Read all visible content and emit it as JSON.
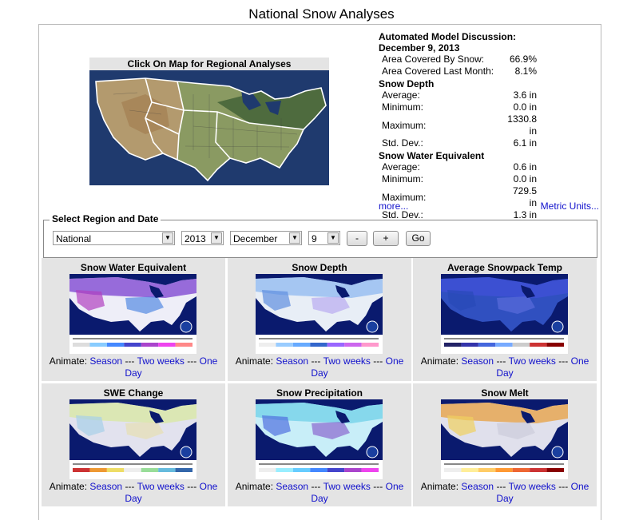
{
  "page": {
    "title": "National Snow Analyses"
  },
  "map": {
    "caption": "Click On Map for Regional Analyses"
  },
  "discussion": {
    "heading": "Automated Model Discussion:",
    "date": "December 9, 2013",
    "coverage": [
      {
        "label": "Area Covered By Snow:",
        "value": "66.9%"
      },
      {
        "label": "Area Covered Last Month:",
        "value": "8.1%"
      }
    ],
    "snow_depth": {
      "title": "Snow Depth",
      "rows": [
        {
          "label": "Average:",
          "value": "3.6 in"
        },
        {
          "label": "Minimum:",
          "value": "0.0 in"
        },
        {
          "label": "Maximum:",
          "value": "1330.8 in"
        },
        {
          "label": "Std. Dev.:",
          "value": "6.1 in"
        }
      ]
    },
    "swe": {
      "title": "Snow Water Equivalent",
      "rows": [
        {
          "label": "Average:",
          "value": "0.6 in"
        },
        {
          "label": "Minimum:",
          "value": "0.0 in"
        },
        {
          "label": "Maximum:",
          "value": "729.5 in"
        },
        {
          "label": "Std. Dev.:",
          "value": "1.3 in"
        }
      ]
    },
    "more_link": "more...",
    "metric_link": "Metric Units..."
  },
  "selector": {
    "legend": "Select Region and Date",
    "region": "National",
    "year": "2013",
    "month": "December",
    "day": "9",
    "minus": "-",
    "plus": "+",
    "go": "Go"
  },
  "panels": [
    {
      "title": "Snow Water Equivalent",
      "palette": "swe"
    },
    {
      "title": "Snow Depth",
      "palette": "depth"
    },
    {
      "title": "Average Snowpack Temp",
      "palette": "temp"
    },
    {
      "title": "SWE Change",
      "palette": "change"
    },
    {
      "title": "Snow Precipitation",
      "palette": "precip"
    },
    {
      "title": "Snow Melt",
      "palette": "melt"
    }
  ],
  "animate": {
    "label": "Animate:",
    "season": "Season",
    "sep": "---",
    "two_weeks": "Two weeks",
    "one": "One",
    "day": "Day"
  },
  "colors": {
    "link": "#1111cc",
    "panel_bg": "#e4e4e4",
    "ocean": "#0a1a6e"
  }
}
